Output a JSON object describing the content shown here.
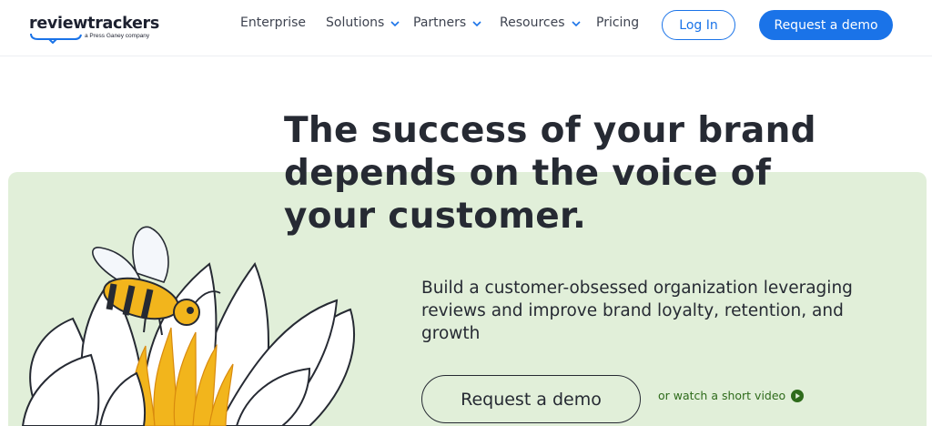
{
  "brand": {
    "name": "reviewtrackers",
    "tagline": "a Press Ganey company",
    "accent": "#1a73e8",
    "hero_bg": "#e1efd9"
  },
  "nav": {
    "items": [
      {
        "label": "Enterprise",
        "has_dropdown": false
      },
      {
        "label": "Solutions",
        "has_dropdown": true
      },
      {
        "label": "Partners",
        "has_dropdown": true
      },
      {
        "label": "Resources",
        "has_dropdown": true
      },
      {
        "label": "Pricing",
        "has_dropdown": false
      }
    ],
    "login_label": "Log In",
    "demo_label": "Request a demo"
  },
  "hero": {
    "headline": "The success of your brand depends on the voice of your customer.",
    "subtext": "Build a customer-obsessed organization leveraging reviews and improve brand loyalty, retention, and growth",
    "cta_label": "Request a demo",
    "video_link_label": "or watch a short video",
    "illustration_icon": "bee-on-lotus-flower-illustration",
    "video_icon": "play-icon"
  }
}
